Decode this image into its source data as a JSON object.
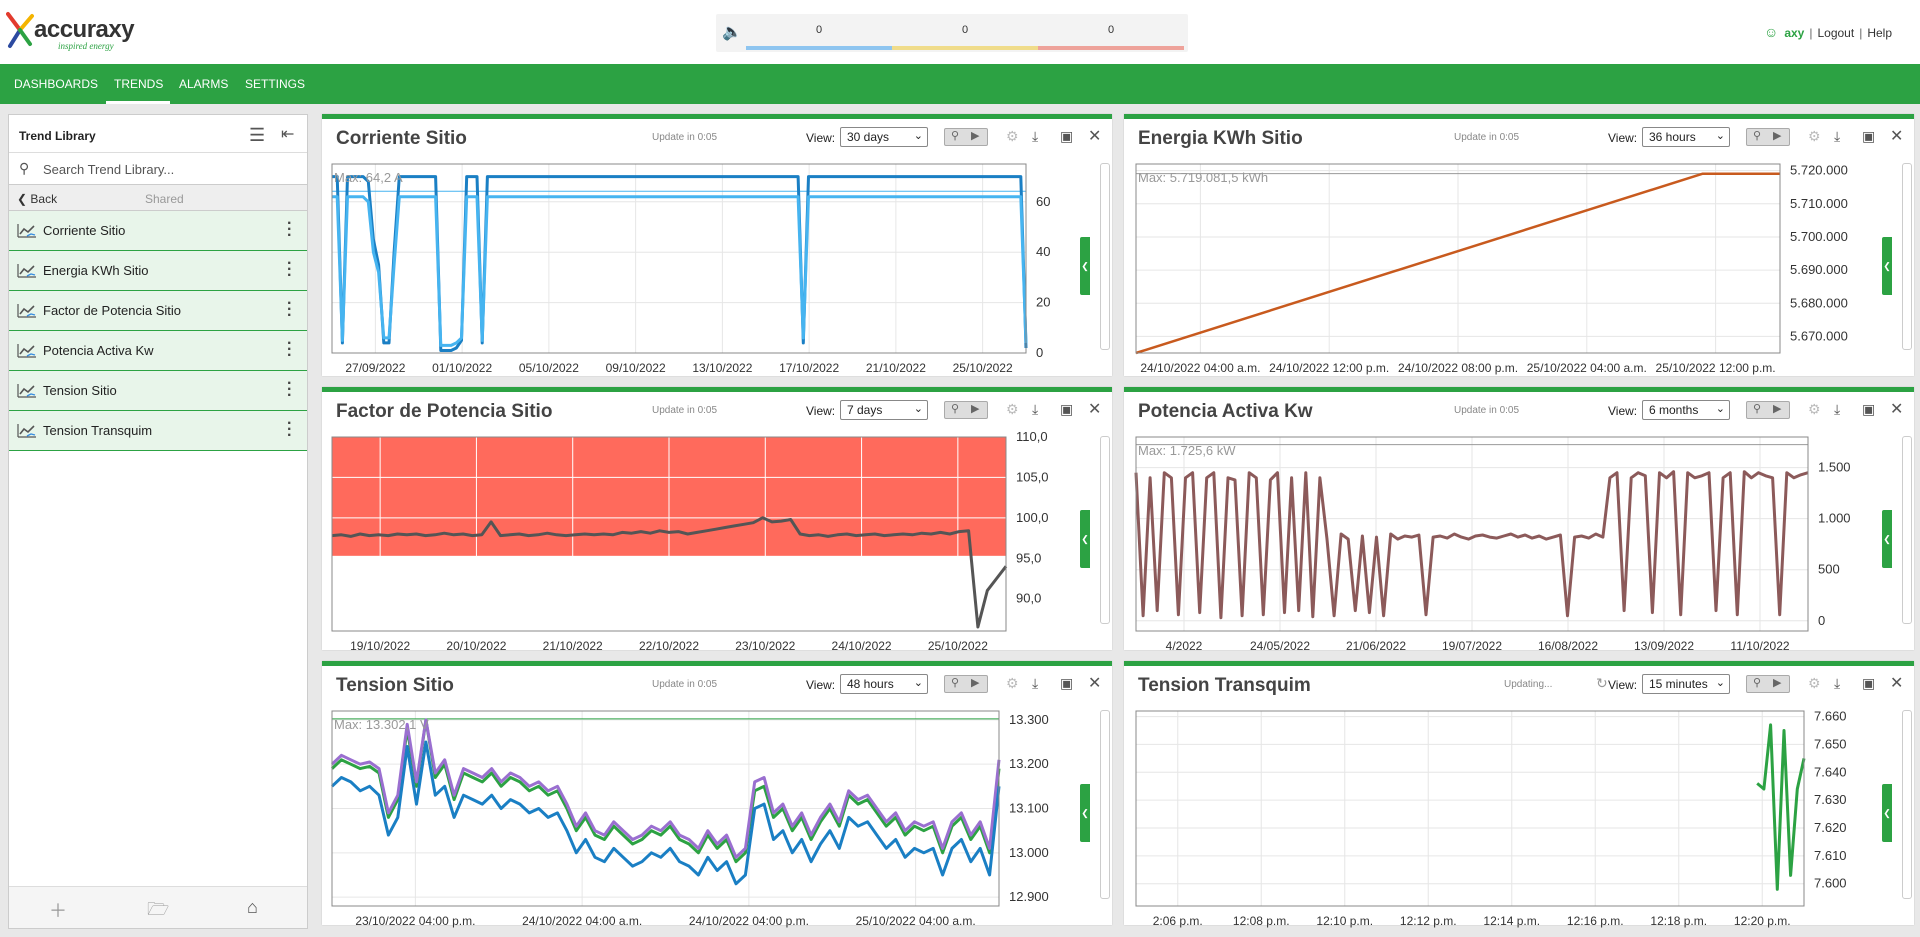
{
  "brand": {
    "name": "accuraxy",
    "tagline": "inspired energy"
  },
  "alarm_counts": [
    {
      "value": "0",
      "color": "#8ec5f0"
    },
    {
      "value": "0",
      "color": "#f0dc8a"
    },
    {
      "value": "0",
      "color": "#eea29a"
    }
  ],
  "user": {
    "name": "axy",
    "logout": "Logout",
    "help": "Help"
  },
  "nav": [
    {
      "label": "DASHBOARDS"
    },
    {
      "label": "TRENDS",
      "active": true
    },
    {
      "label": "ALARMS"
    },
    {
      "label": "SETTINGS"
    }
  ],
  "sidebar": {
    "title": "Trend Library",
    "search_placeholder": "Search Trend Library...",
    "back": "Back",
    "shared": "Shared",
    "items": [
      {
        "label": "Corriente Sitio"
      },
      {
        "label": "Energia KWh Sitio"
      },
      {
        "label": "Factor de Potencia Sitio"
      },
      {
        "label": "Potencia Activa Kw"
      },
      {
        "label": "Tension Sitio"
      },
      {
        "label": "Tension Transquim"
      }
    ]
  },
  "view_label": "View:",
  "panels": [
    {
      "title": "Corriente Sitio",
      "update": "Update in 0:05",
      "view": "30 days"
    },
    {
      "title": "Energia KWh Sitio",
      "update": "Update in 0:05",
      "view": "36 hours"
    },
    {
      "title": "Factor de Potencia Sitio",
      "update": "Update in 0:05",
      "view": "7 days"
    },
    {
      "title": "Potencia Activa Kw",
      "update": "Update in 0:05",
      "view": "6 months"
    },
    {
      "title": "Tension Sitio",
      "update": "Update in 0:05",
      "view": "48 hours"
    },
    {
      "title": "Tension Transquim",
      "update": "Updating...",
      "view": "15 minutes"
    }
  ],
  "chart_data": [
    {
      "type": "line",
      "title": "Corriente Sitio",
      "annotation": "Max: 64,2 A",
      "x_ticks": [
        "27/09/2022",
        "01/10/2022",
        "05/10/2022",
        "09/10/2022",
        "13/10/2022",
        "17/10/2022",
        "21/10/2022",
        "25/10/2022"
      ],
      "y_ticks": [
        "0",
        "20",
        "40",
        "60"
      ],
      "ylim": [
        0,
        75
      ],
      "series": [
        {
          "color": "#1a7fc4",
          "values": [
            70,
            70,
            4,
            70,
            70,
            70,
            70,
            68,
            45,
            35,
            4,
            4,
            40,
            70,
            70,
            70,
            70,
            70,
            70,
            70,
            70,
            1,
            1,
            1,
            2,
            5,
            70,
            70,
            70,
            4,
            70,
            70,
            70,
            70,
            70,
            70,
            70,
            70,
            70,
            70,
            70,
            70,
            70,
            70,
            70,
            70,
            70,
            70,
            70,
            70,
            70,
            70,
            70,
            70,
            70,
            70,
            70,
            70,
            70,
            70,
            70,
            70,
            70,
            70,
            70,
            70,
            70,
            70,
            70,
            70,
            70,
            70,
            70,
            70,
            70,
            70,
            70,
            70,
            70,
            70,
            70,
            70,
            70,
            70,
            70,
            70,
            70,
            70,
            70,
            70,
            70,
            4,
            70,
            70,
            70,
            70,
            70,
            70,
            70,
            70,
            70,
            70,
            70,
            70,
            70,
            70,
            70,
            70,
            70,
            70,
            70,
            70,
            70,
            70,
            70,
            70,
            70,
            70,
            70,
            70,
            70,
            70,
            70,
            70,
            70,
            70,
            70,
            70,
            70,
            70,
            70,
            70,
            70,
            70,
            2
          ]
        },
        {
          "color": "#46b4f0",
          "values": [
            62,
            62,
            5,
            62,
            62,
            62,
            62,
            60,
            40,
            32,
            6,
            6,
            35,
            62,
            62,
            62,
            62,
            62,
            62,
            62,
            62,
            3,
            3,
            3,
            4,
            6,
            62,
            62,
            62,
            5,
            62,
            62,
            62,
            62,
            62,
            62,
            62,
            62,
            62,
            62,
            62,
            62,
            62,
            62,
            62,
            62,
            62,
            62,
            62,
            62,
            62,
            62,
            62,
            62,
            62,
            62,
            62,
            62,
            62,
            62,
            62,
            62,
            62,
            62,
            62,
            62,
            62,
            62,
            62,
            62,
            62,
            62,
            62,
            62,
            62,
            62,
            62,
            62,
            62,
            62,
            62,
            62,
            62,
            62,
            62,
            62,
            62,
            62,
            62,
            62,
            62,
            6,
            62,
            62,
            62,
            62,
            62,
            62,
            62,
            62,
            62,
            62,
            62,
            62,
            62,
            62,
            62,
            62,
            62,
            62,
            62,
            62,
            62,
            62,
            62,
            62,
            62,
            62,
            62,
            62,
            62,
            62,
            62,
            62,
            62,
            62,
            62,
            62,
            62,
            62,
            62,
            62,
            62,
            62,
            4
          ]
        }
      ],
      "max_line": 64.2
    },
    {
      "type": "line",
      "title": "Energia KWh Sitio",
      "annotation": "Max: 5.719.081,5 kWh",
      "x_ticks": [
        "24/10/2022 04:00 a.m.",
        "24/10/2022 12:00 p.m.",
        "24/10/2022 08:00 p.m.",
        "25/10/2022 04:00 a.m.",
        "25/10/2022 12:00 p.m."
      ],
      "y_ticks": [
        "5.670.000",
        "5.680.000",
        "5.690.000",
        "5.700.000",
        "5.710.000",
        "5.720.000"
      ],
      "ylim": [
        5665000,
        5722000
      ],
      "series": [
        {
          "color": "#c85a1e",
          "x": [
            0,
            0.88,
            1
          ],
          "values": [
            5665000,
            5719081.5,
            5719081.5
          ]
        }
      ],
      "max_line": 5719081.5
    },
    {
      "type": "line",
      "title": "Factor de Potencia Sitio",
      "x_ticks": [
        "19/10/2022",
        "20/10/2022",
        "21/10/2022",
        "22/10/2022",
        "23/10/2022",
        "24/10/2022",
        "25/10/2022"
      ],
      "y_ticks": [
        "90,0",
        "95,0",
        "100,0",
        "105,0",
        "110,0"
      ],
      "ylim": [
        86,
        110
      ],
      "band": {
        "from": 95.3,
        "to": 110,
        "color": "#ff6a5c"
      },
      "series": [
        {
          "color": "#555555",
          "values": [
            97.8,
            97.9,
            97.7,
            98.0,
            97.8,
            97.9,
            97.8,
            98.0,
            97.9,
            98.0,
            97.8,
            97.9,
            98.1,
            97.9,
            98.0,
            97.8,
            97.9,
            99.5,
            97.8,
            97.9,
            98.0,
            97.8,
            97.9,
            98.1,
            97.9,
            97.8,
            97.9,
            98.0,
            97.9,
            98.0,
            97.9,
            98.2,
            98.1,
            98.3,
            98.1,
            98.4,
            98.2,
            98.3,
            98.0,
            98.2,
            98.4,
            98.6,
            98.8,
            99.0,
            99.2,
            99.4,
            100.0,
            99.5,
            99.6,
            99.8,
            98.0,
            97.8,
            97.9,
            97.7,
            97.9,
            98.0,
            97.8,
            97.9,
            98.0,
            97.8,
            97.9,
            98.0,
            97.9,
            98.1,
            98.0,
            98.2,
            98.0,
            98.3,
            98.4,
            86.5,
            91.0,
            92.5,
            94.0
          ]
        }
      ]
    },
    {
      "type": "line",
      "title": "Potencia Activa Kw",
      "annotation": "Max: 1.725,6 kW",
      "x_ticks": [
        "4/2022",
        "24/05/2022",
        "21/06/2022",
        "19/07/2022",
        "16/08/2022",
        "13/09/2022",
        "11/10/2022"
      ],
      "y_ticks": [
        "0",
        "500",
        "1.000",
        "1.500"
      ],
      "ylim": [
        -100,
        1800
      ],
      "series": [
        {
          "color": "#8c5a5a",
          "values": [
            1450,
            50,
            1400,
            100,
            1450,
            1400,
            60,
            1400,
            1450,
            80,
            1400,
            1450,
            30,
            1400,
            1380,
            50,
            1450,
            1400,
            60,
            1380,
            1450,
            80,
            1400,
            100,
            1450,
            40,
            1400,
            800,
            50,
            850,
            800,
            100,
            830,
            80,
            820,
            50,
            850,
            800,
            830,
            820,
            840,
            60,
            820,
            830,
            810,
            850,
            820,
            800,
            830,
            840,
            820,
            810,
            830,
            850,
            820,
            840,
            810,
            830,
            800,
            820,
            840,
            50,
            820,
            830,
            810,
            850,
            820,
            1400,
            1450,
            100,
            1400,
            1450,
            1420,
            80,
            1450,
            1400,
            1460,
            60,
            1450,
            1400,
            1420,
            1450,
            100,
            1400,
            1450,
            60,
            1460,
            1400,
            1450,
            1420,
            1400,
            60,
            1450,
            1400,
            1430,
            1450
          ]
        }
      ],
      "max_line": 1725.6
    },
    {
      "type": "line",
      "title": "Tension Sitio",
      "annotation": "Max: 13.302,1 V",
      "x_ticks": [
        "23/10/2022 04:00 p.m.",
        "24/10/2022 04:00 a.m.",
        "24/10/2022 04:00 p.m.",
        "25/10/2022 04:00 a.m."
      ],
      "y_ticks": [
        "12.900",
        "13.000",
        "13.100",
        "13.200",
        "13.300"
      ],
      "ylim": [
        12880,
        13320
      ],
      "series": [
        {
          "color": "#2ca243",
          "values": [
            13190,
            13210,
            13200,
            13190,
            13195,
            13180,
            13080,
            13120,
            13280,
            13150,
            13300,
            13170,
            13200,
            13120,
            13180,
            13170,
            13160,
            13180,
            13150,
            13170,
            13160,
            13140,
            13150,
            13130,
            13140,
            13100,
            13050,
            13080,
            13040,
            13030,
            13060,
            13040,
            13020,
            13030,
            13050,
            13040,
            13060,
            13030,
            13020,
            13000,
            13040,
            13010,
            13030,
            12980,
            13000,
            13140,
            13150,
            13080,
            13100,
            13050,
            13080,
            13030,
            13070,
            13100,
            13060,
            13130,
            13110,
            13120,
            13090,
            13060,
            13080,
            13040,
            13060,
            13050,
            13060,
            13000,
            13060,
            13080,
            13030,
            13060,
            13000,
            13190
          ]
        },
        {
          "color": "#9a6fd0",
          "values": [
            13200,
            13220,
            13210,
            13200,
            13205,
            13190,
            13090,
            13130,
            13290,
            13160,
            13300,
            13180,
            13210,
            13130,
            13190,
            13180,
            13170,
            13190,
            13160,
            13180,
            13170,
            13150,
            13160,
            13140,
            13150,
            13110,
            13060,
            13090,
            13050,
            13040,
            13070,
            13050,
            13030,
            13040,
            13060,
            13050,
            13070,
            13040,
            13030,
            13010,
            13050,
            13020,
            13040,
            12990,
            13010,
            13160,
            13170,
            13090,
            13110,
            13060,
            13090,
            13040,
            13080,
            13110,
            13070,
            13140,
            13120,
            13130,
            13100,
            13070,
            13090,
            13050,
            13070,
            13060,
            13070,
            13010,
            13070,
            13090,
            13040,
            13070,
            13010,
            13210
          ]
        },
        {
          "color": "#1a7fc4",
          "values": [
            13150,
            13170,
            13160,
            13140,
            13150,
            13130,
            13040,
            13080,
            13240,
            13110,
            13250,
            13130,
            13150,
            13080,
            13130,
            13120,
            13110,
            13130,
            13100,
            13120,
            13110,
            13090,
            13100,
            13080,
            13090,
            13050,
            13000,
            13030,
            12990,
            12980,
            13010,
            12990,
            12970,
            12980,
            13000,
            12990,
            13010,
            12980,
            12970,
            12950,
            12990,
            12960,
            12980,
            12930,
            12950,
            13100,
            13110,
            13030,
            13050,
            13000,
            13030,
            12980,
            13020,
            13050,
            13010,
            13080,
            13060,
            13070,
            13040,
            13010,
            13030,
            12990,
            13010,
            13000,
            13010,
            12950,
            13010,
            13030,
            12980,
            13010,
            12950,
            13150
          ]
        }
      ],
      "max_line": 13302.1
    },
    {
      "type": "line",
      "title": "Tension Transquim",
      "x_ticks": [
        "2:06 p.m.",
        "12:08 p.m.",
        "12:10 p.m.",
        "12:12 p.m.",
        "12:14 p.m.",
        "12:16 p.m.",
        "12:18 p.m.",
        "12:20 p.m."
      ],
      "y_ticks": [
        "7.600",
        "7.610",
        "7.620",
        "7.630",
        "7.640",
        "7.650",
        "7.660"
      ],
      "ylim": [
        7592,
        7662
      ],
      "series": [
        {
          "color": "#2ca243",
          "x": [
            0.93,
            0.94,
            0.95,
            0.96,
            0.97,
            0.98,
            0.99,
            1.0
          ],
          "values": [
            7636,
            7634,
            7657,
            7598,
            7655,
            7603,
            7634,
            7645
          ]
        }
      ]
    }
  ]
}
